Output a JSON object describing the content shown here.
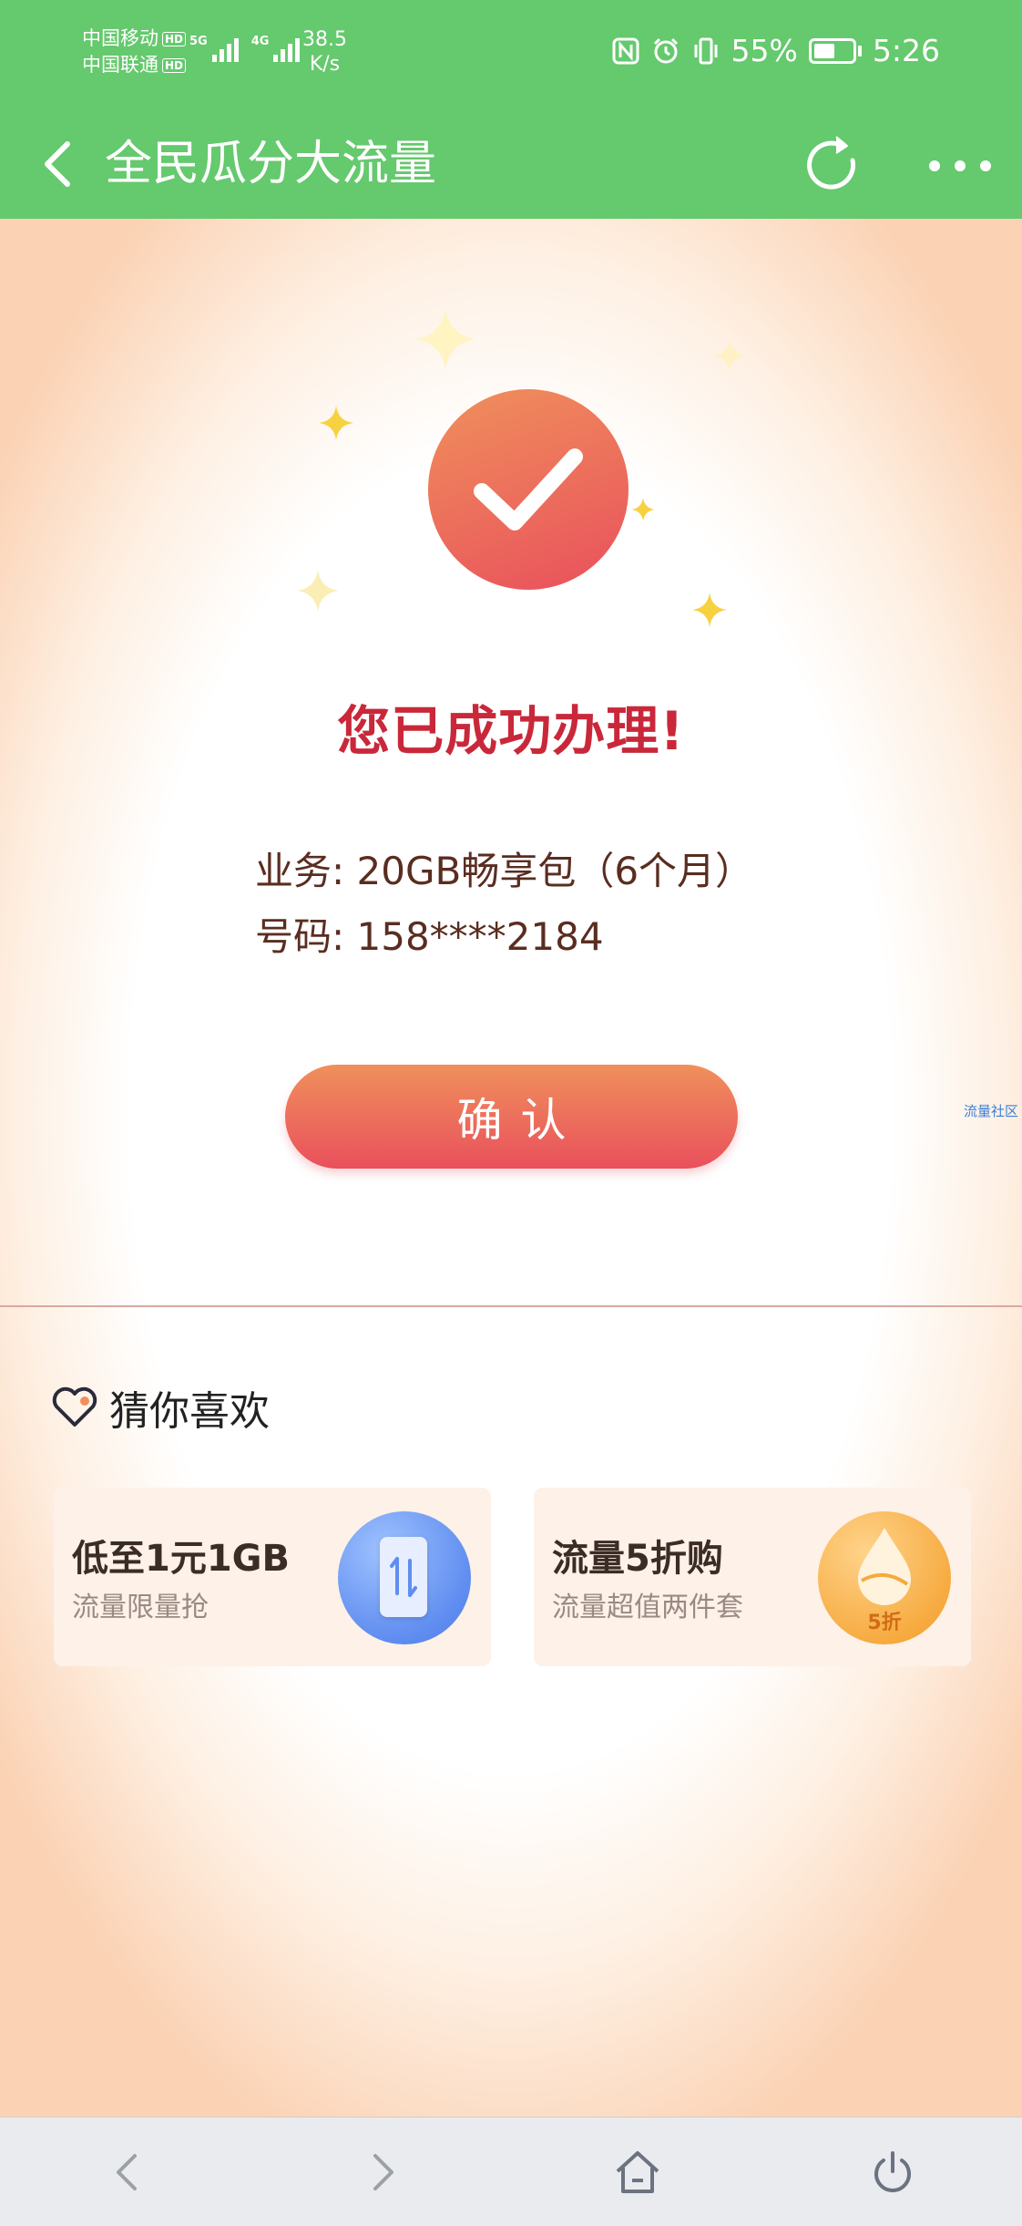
{
  "status_bar": {
    "carrier_1": "中国移动",
    "carrier_2": "中国联通",
    "hd_badge": "HD",
    "sig_5g": "5G",
    "sig_4g": "4G",
    "net_speed_value": "38.5",
    "net_speed_unit": "K/s",
    "battery_percent": "55%",
    "time": "5:26"
  },
  "nav": {
    "title": "全民瓜分大流量"
  },
  "result": {
    "title": "您已成功办理!",
    "service_label": "业务:",
    "service_value": "20GB畅享包（6个月）",
    "number_label": "号码:",
    "number_value": "158****2184",
    "confirm_label": "确认"
  },
  "side_link": "流量社区",
  "recommend": {
    "title": "猜你喜欢",
    "cards": [
      {
        "title": "低至1元1GB",
        "subtitle": "流量限量抢",
        "icon": "data-transfer-icon"
      },
      {
        "title": "流量5折购",
        "subtitle": "流量超值两件套",
        "icon": "droplet-icon",
        "badge": "5折"
      }
    ]
  },
  "colors": {
    "header_green": "#65c96e",
    "accent_red": "#c9283a",
    "button_gradient_start": "#f0905c",
    "button_gradient_end": "#e9505c"
  }
}
